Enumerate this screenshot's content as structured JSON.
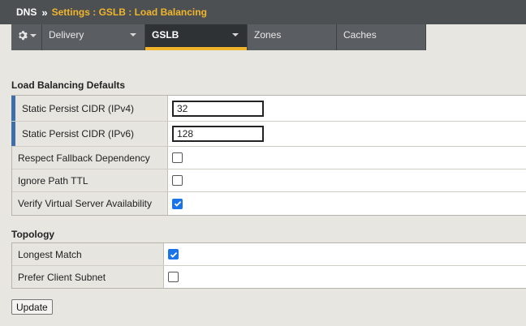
{
  "titlebar": {
    "root": "DNS",
    "separator": "»",
    "path": "Settings : GSLB : Load Balancing"
  },
  "tabs": {
    "gear_icon": "gear-icon",
    "items": [
      {
        "label": "Delivery",
        "active": false,
        "has_menu": true
      },
      {
        "label": "GSLB",
        "active": true,
        "has_menu": true
      },
      {
        "label": "Zones",
        "active": false,
        "has_menu": false
      },
      {
        "label": "Caches",
        "active": false,
        "has_menu": false
      }
    ]
  },
  "load_balancing": {
    "title": "Load Balancing Defaults",
    "static_persist_ipv4": {
      "label": "Static Persist CIDR (IPv4)",
      "value": "32"
    },
    "static_persist_ipv6": {
      "label": "Static Persist CIDR (IPv6)",
      "value": "128"
    },
    "respect_fallback": {
      "label": "Respect Fallback Dependency",
      "checked": false
    },
    "ignore_path_ttl": {
      "label": "Ignore Path TTL",
      "checked": false
    },
    "verify_vs_availability": {
      "label": "Verify Virtual Server Availability",
      "checked": true
    }
  },
  "topology": {
    "title": "Topology",
    "longest_match": {
      "label": "Longest Match",
      "checked": true
    },
    "prefer_client_subnet": {
      "label": "Prefer Client Subnet",
      "checked": false
    }
  },
  "actions": {
    "update_label": "Update"
  },
  "colors": {
    "titlebar_bg": "#4c5053",
    "breadcrumb_accent": "#f1b52c",
    "active_tab_underline": "#f1b52c",
    "required_marker": "#3e6fa8",
    "checkbox_checked": "#1a73e8"
  }
}
